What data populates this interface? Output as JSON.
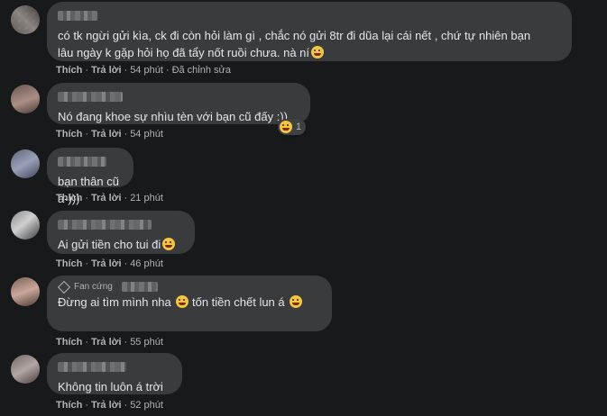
{
  "actions": {
    "like": "Thích",
    "reply": "Trả lời",
    "separator": "·"
  },
  "comments": [
    {
      "text": "có tk ngừi gửi kìa, ck đi còn hỏi làm gì , chắc nó gửi 8tr đi dũa lại cái nết , chứ tự nhiên bạn\nlâu ngày k gặp hỏi họ đã tẩy nốt ruồi chưa. nà ní",
      "emoji": "shocked-face",
      "time": "54 phút",
      "edited": "Đã chỉnh sửa"
    },
    {
      "text": "Nó đang khoe sự nhìu tèn với bạn cũ đấy :))",
      "time": "54 phút",
      "reaction": {
        "emoji": "laughing-face",
        "count": "1"
      }
    },
    {
      "text": "bạn thân cũ à-)))",
      "time": "21 phút"
    },
    {
      "text": "Ai gửi tiền cho tui đi",
      "emoji": "grinning-face",
      "time": "46 phút"
    },
    {
      "badge": "Fan cứng",
      "text_a": "Đừng ai tìm mình nha",
      "text_b": " tốn tiền chết lun á",
      "emoji": "rofl-face",
      "time": "55 phút"
    },
    {
      "text": "Không tin luôn á trời",
      "time": "52 phút"
    }
  ]
}
